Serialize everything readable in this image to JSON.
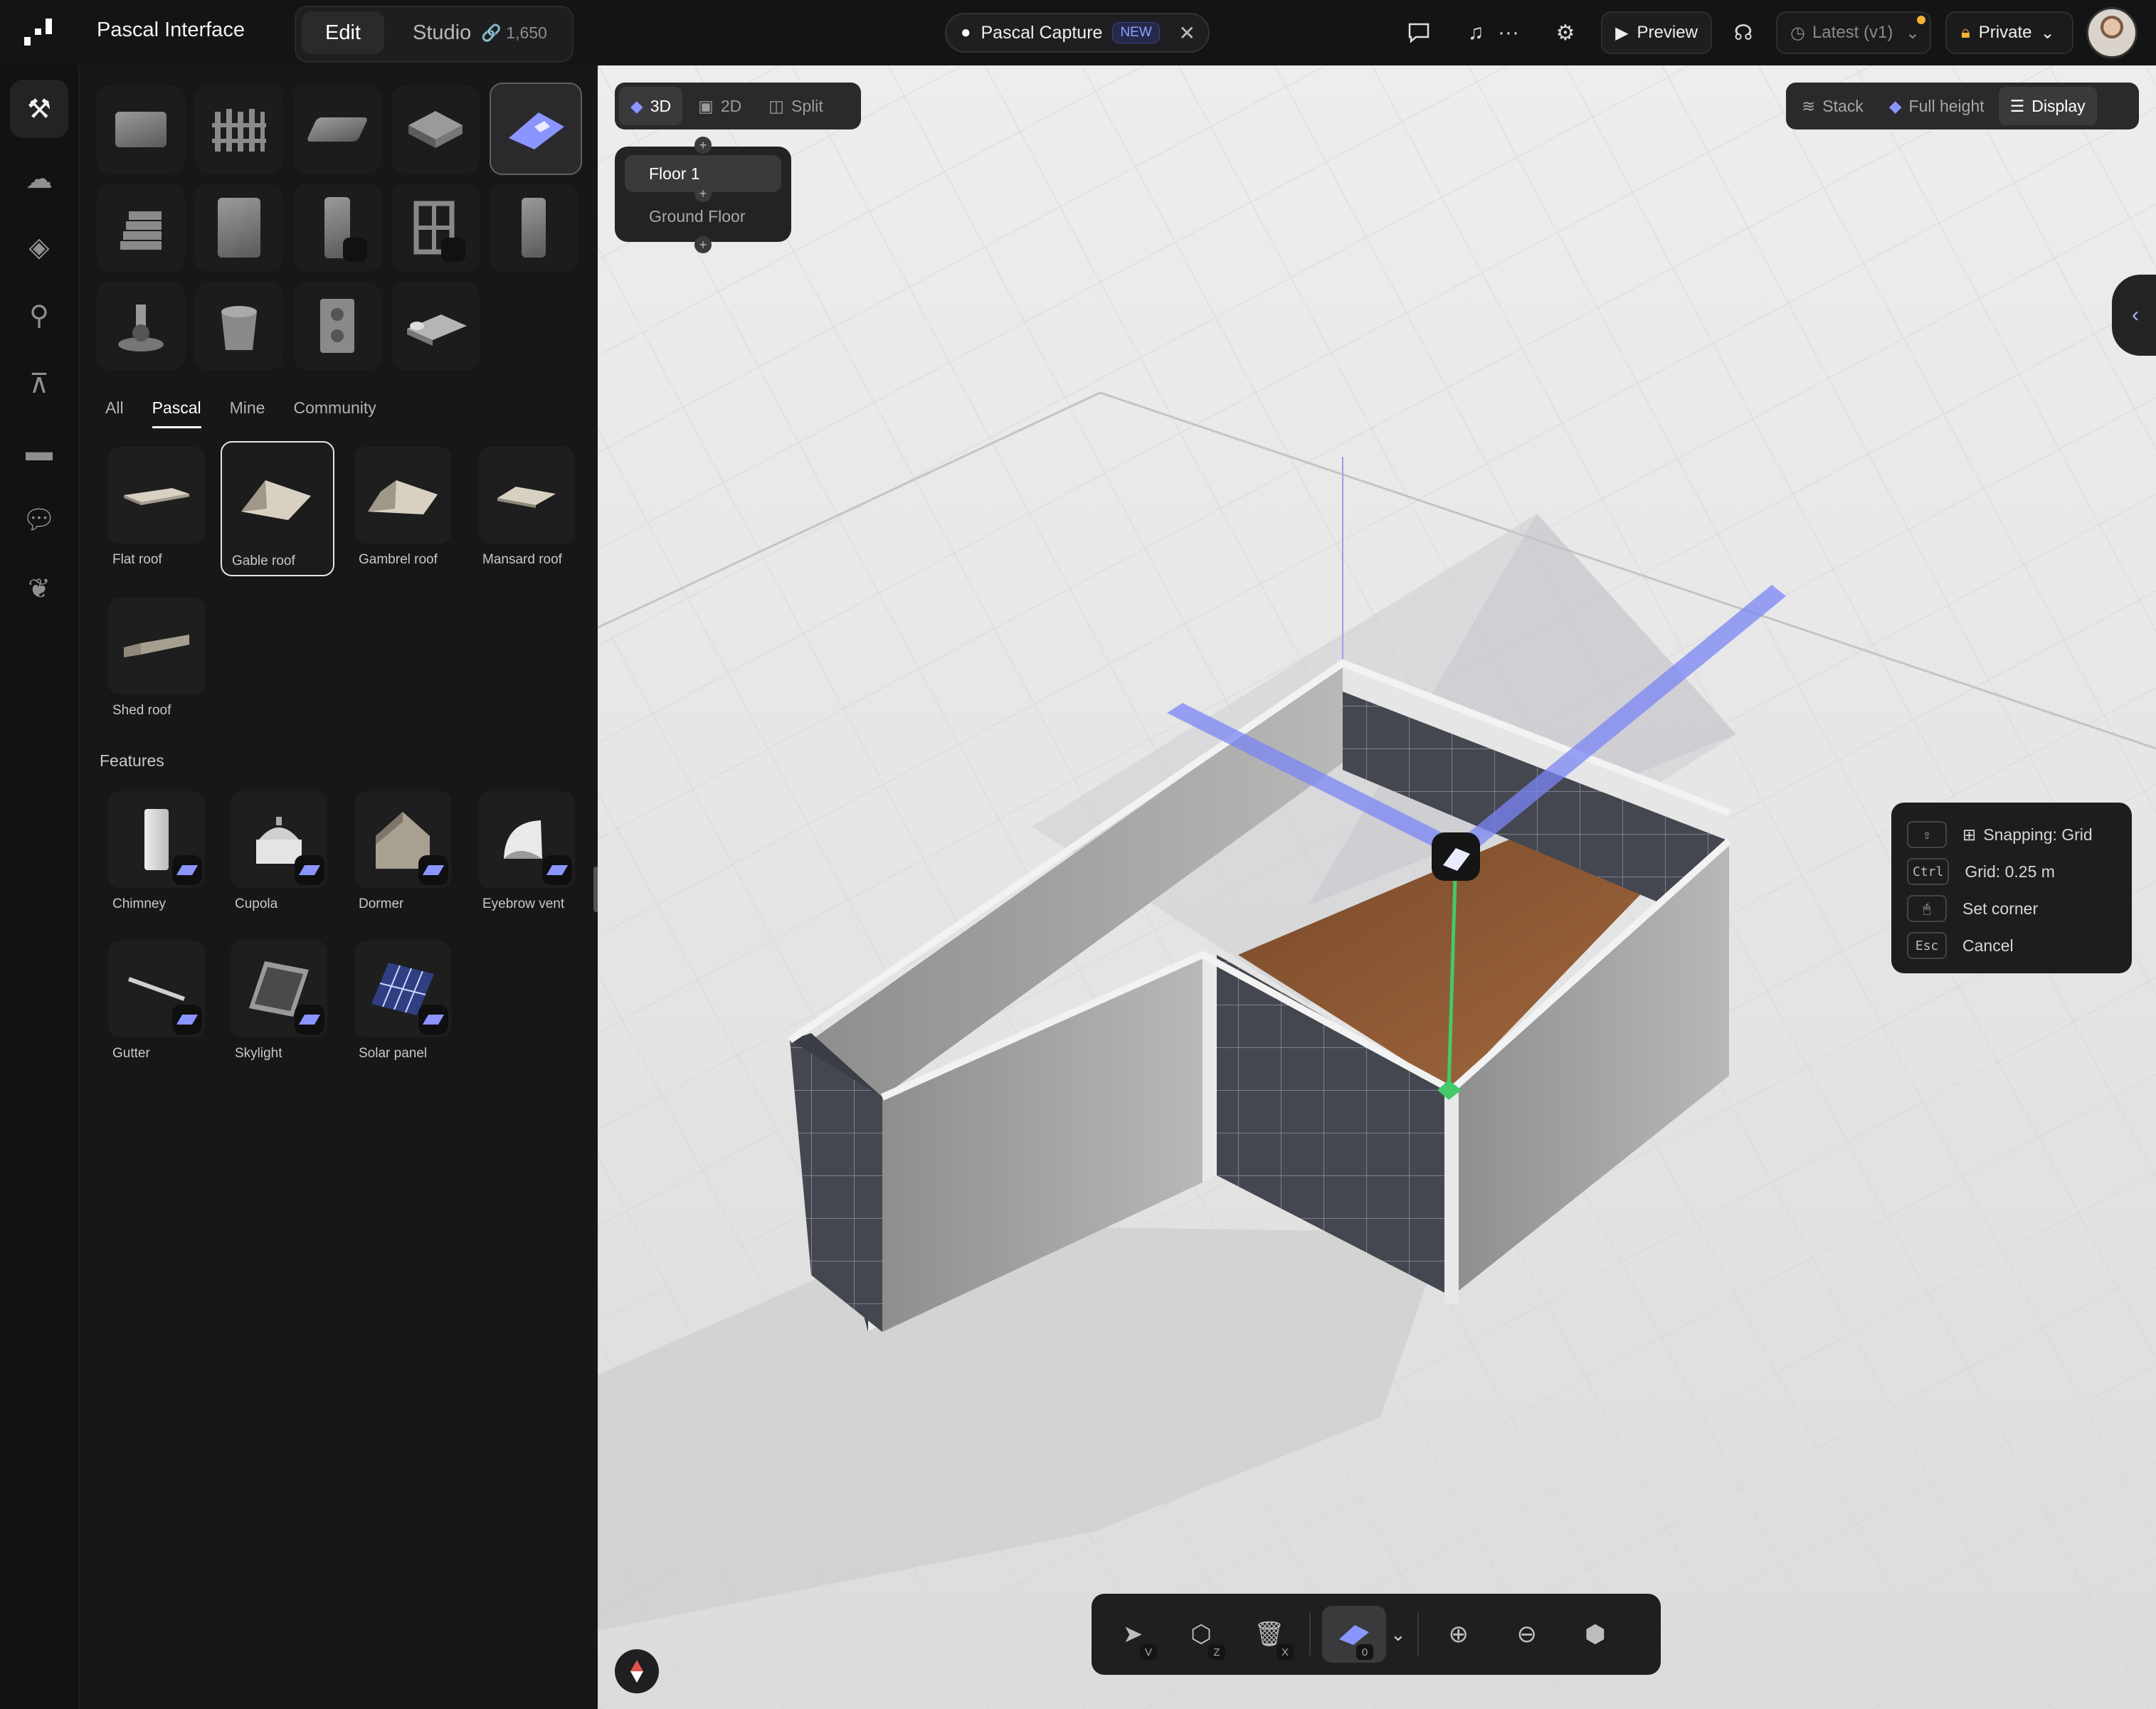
{
  "app": {
    "title": "Pascal Interface",
    "mode_tabs": {
      "edit": "Edit",
      "studio": "Studio",
      "studio_count": "1,650"
    }
  },
  "capture": {
    "label": "Pascal Capture",
    "badge": "NEW"
  },
  "topbar": {
    "preview": "Preview",
    "version": "Latest (v1)",
    "visibility": "Private",
    "icons": [
      "chat-icon",
      "music-icon",
      "more-icon",
      "settings-icon",
      "headphones-icon"
    ]
  },
  "rail": [
    "build-icon",
    "zones-icon",
    "floors-icon",
    "search-icon",
    "hierarchy-icon",
    "folder-icon",
    "comments-icon",
    "plant-icon"
  ],
  "library": {
    "tabs": [
      "All",
      "Pascal",
      "Mine",
      "Community"
    ],
    "active_tab": "Pascal",
    "roofs": [
      {
        "label": "Flat roof"
      },
      {
        "label": "Gable roof"
      },
      {
        "label": "Gambrel roof"
      },
      {
        "label": "Mansard roof"
      },
      {
        "label": "Shed roof"
      }
    ],
    "features_heading": "Features",
    "features": [
      {
        "label": "Chimney"
      },
      {
        "label": "Cupola"
      },
      {
        "label": "Dormer"
      },
      {
        "label": "Eyebrow vent"
      },
      {
        "label": "Gutter"
      },
      {
        "label": "Skylight"
      },
      {
        "label": "Solar panel"
      }
    ]
  },
  "viewport": {
    "view_modes": [
      "3D",
      "2D",
      "Split"
    ],
    "active_view": "3D",
    "floors": [
      "Floor 1",
      "Ground Floor"
    ],
    "display": {
      "stack": "Stack",
      "full_height": "Full height",
      "display": "Display"
    },
    "shortcuts": [
      {
        "key": "⇧",
        "label": "Snapping: Grid"
      },
      {
        "key": "Ctrl",
        "label": "Grid: 0.25 m"
      },
      {
        "key": "🖱",
        "label": "Set corner"
      },
      {
        "key": "Esc",
        "label": "Cancel"
      }
    ],
    "toolbar_keys": {
      "select": "V",
      "box": "Z",
      "delete": "X",
      "roof": "0"
    }
  },
  "colors": {
    "accent": "#7b86f5",
    "panel": "#171717",
    "viewport": "#e8e8e8",
    "guide": "#44c96a"
  }
}
